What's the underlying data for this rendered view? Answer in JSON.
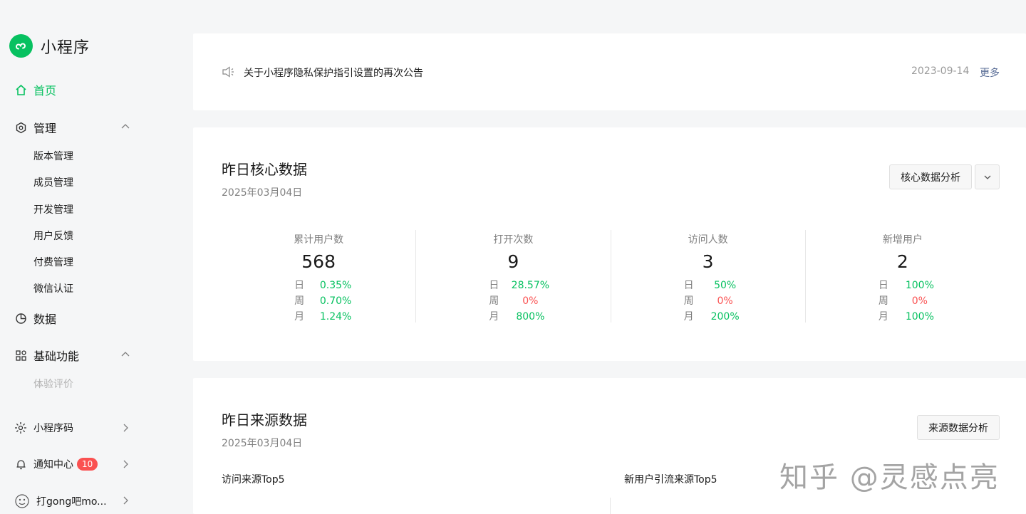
{
  "brand": {
    "name": "小程序"
  },
  "sidebar": {
    "home": "首页",
    "manage": "管理",
    "manage_items": [
      "版本管理",
      "成员管理",
      "开发管理",
      "用户反馈",
      "付费管理",
      "微信认证"
    ],
    "data": "数据",
    "basic": "基础功能",
    "basic_items": [
      "体验评价"
    ],
    "qrcode": "小程序码",
    "notify": "通知中心",
    "notify_badge": "10",
    "account": "打gong吧mo..."
  },
  "notice": {
    "title": "关于小程序隐私保护指引设置的再次公告",
    "date": "2023-09-14",
    "more": "更多"
  },
  "core": {
    "title": "昨日核心数据",
    "date": "2025年03月04日",
    "analysis_button": "核心数据分析",
    "metrics": [
      {
        "label": "累计用户数",
        "value": "568",
        "rows": [
          {
            "k": "日",
            "v": "0.35%",
            "trend": "up"
          },
          {
            "k": "周",
            "v": "0.70%",
            "trend": "up"
          },
          {
            "k": "月",
            "v": "1.24%",
            "trend": "up"
          }
        ]
      },
      {
        "label": "打开次数",
        "value": "9",
        "rows": [
          {
            "k": "日",
            "v": "28.57%",
            "trend": "up"
          },
          {
            "k": "周",
            "v": "0%",
            "trend": "down"
          },
          {
            "k": "月",
            "v": "800%",
            "trend": "up"
          }
        ]
      },
      {
        "label": "访问人数",
        "value": "3",
        "rows": [
          {
            "k": "日",
            "v": "50%",
            "trend": "up"
          },
          {
            "k": "周",
            "v": "0%",
            "trend": "down"
          },
          {
            "k": "月",
            "v": "200%",
            "trend": "up"
          }
        ]
      },
      {
        "label": "新增用户",
        "value": "2",
        "rows": [
          {
            "k": "日",
            "v": "100%",
            "trend": "up"
          },
          {
            "k": "周",
            "v": "0%",
            "trend": "down"
          },
          {
            "k": "月",
            "v": "100%",
            "trend": "up"
          }
        ]
      }
    ]
  },
  "source": {
    "title": "昨日来源数据",
    "date": "2025年03月04日",
    "analysis_button": "来源数据分析",
    "left_head": "访问来源Top5",
    "right_head": "新用户引流来源Top5"
  },
  "watermark": "知乎 @灵感点亮",
  "colors": {
    "accent": "#07c160",
    "down": "#fa5151",
    "link": "#576b95"
  }
}
